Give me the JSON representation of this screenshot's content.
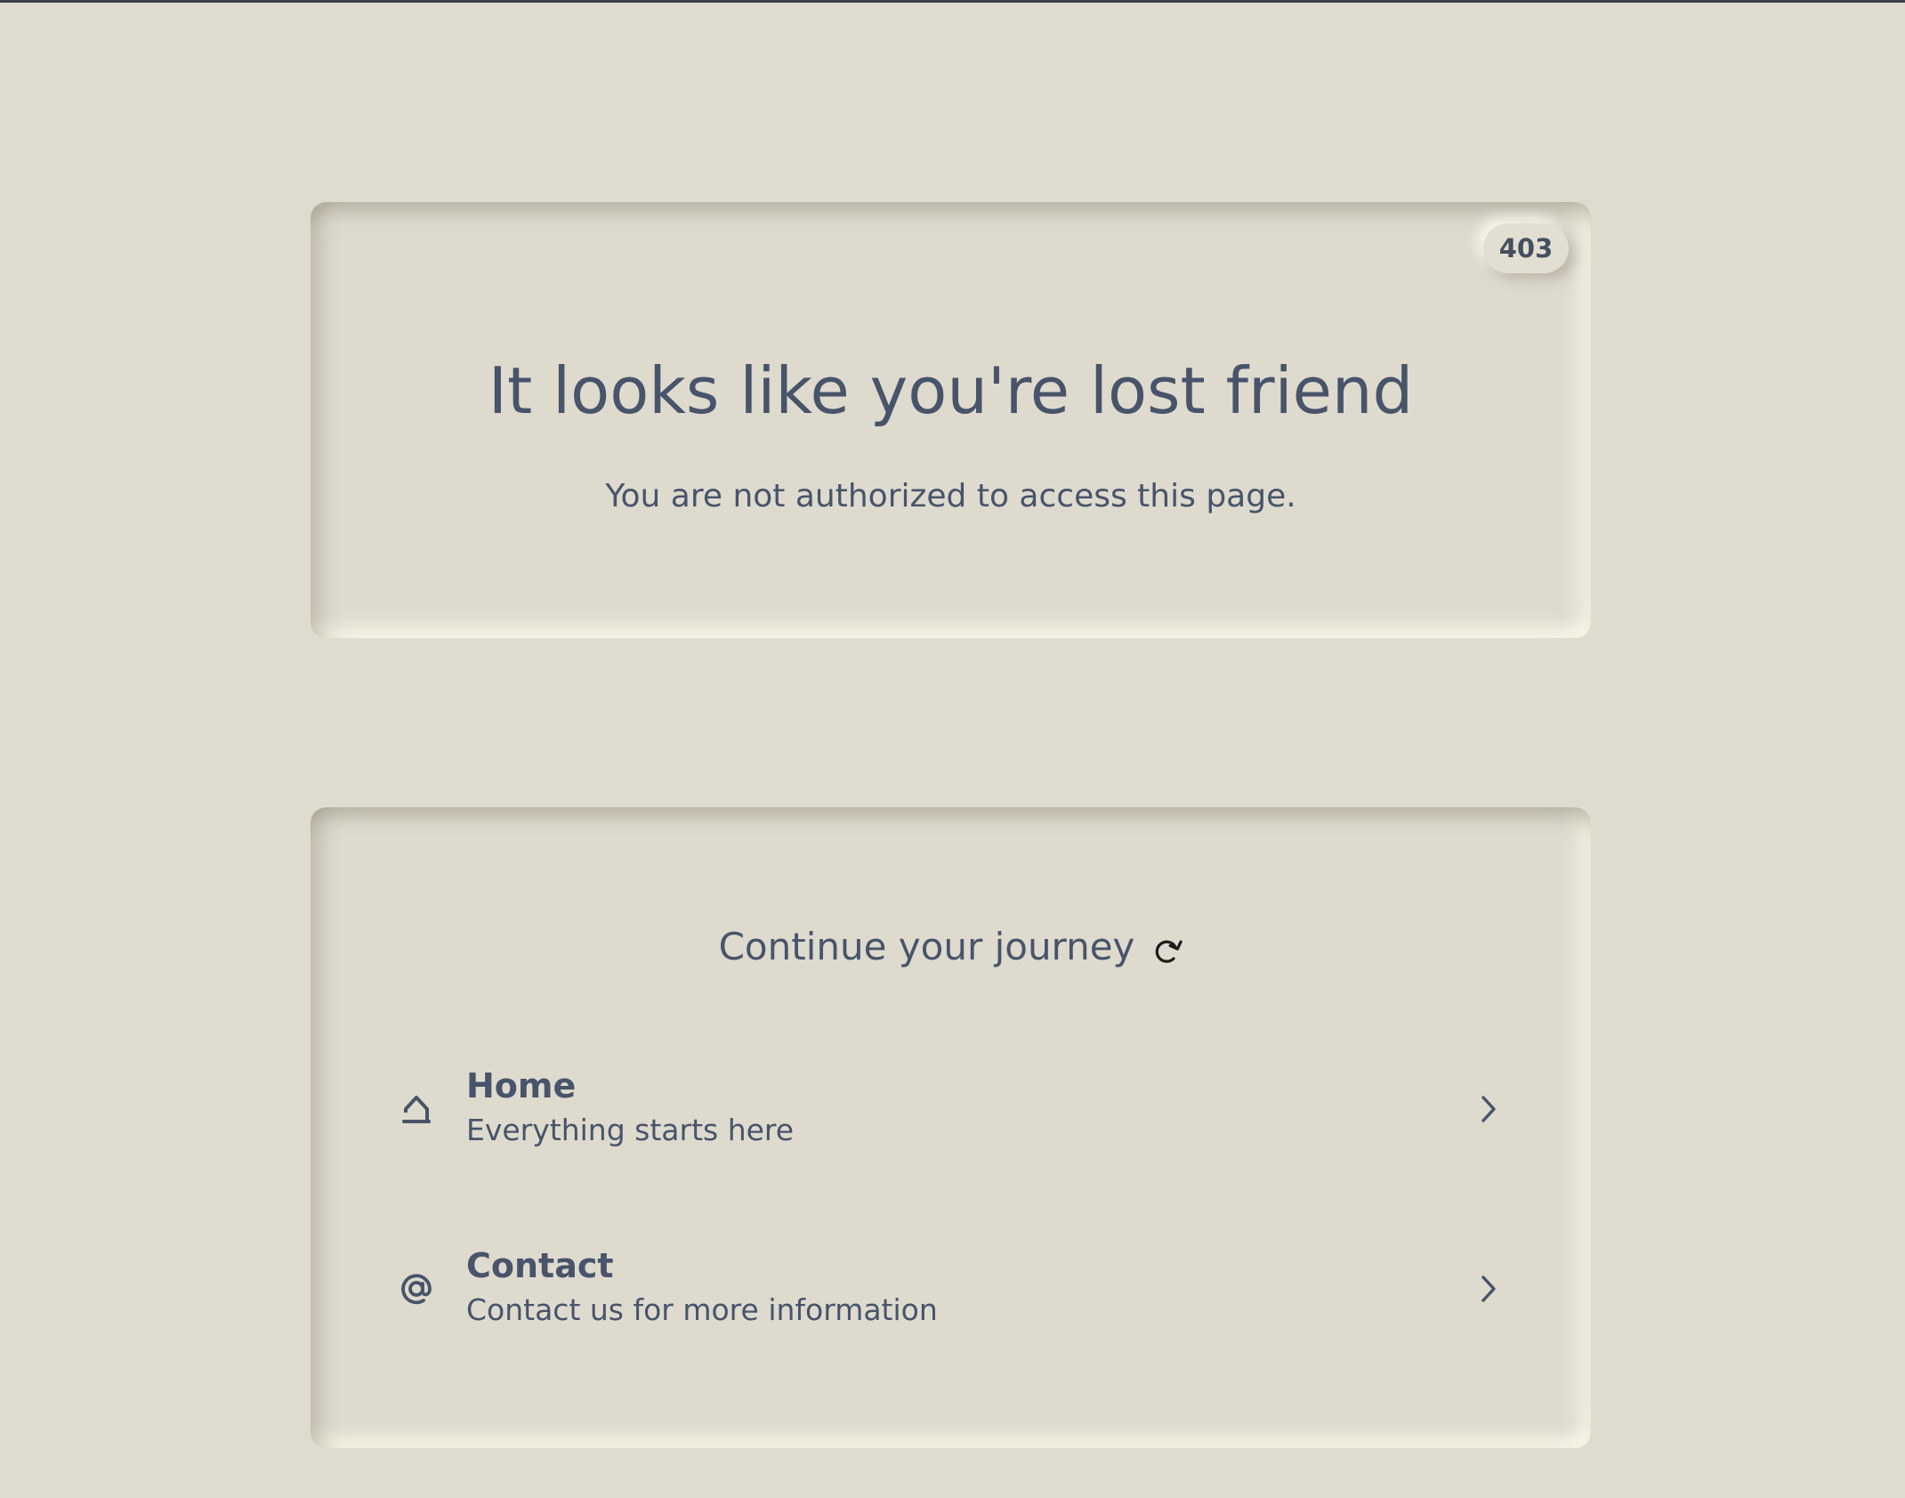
{
  "error_card": {
    "code": "403",
    "title": "It looks like you're lost friend",
    "subtitle": "You are not authorized to access this page."
  },
  "journey_card": {
    "heading": "Continue your journey",
    "heading_icon": "refresh-arrow-icon",
    "links": [
      {
        "title": "Home",
        "description": "Everything starts here",
        "icon": "home-icon"
      },
      {
        "title": "Contact",
        "description": "Contact us for more information",
        "icon": "at-sign-icon"
      }
    ]
  },
  "colors": {
    "background": "#dfdbcf",
    "text": "#47546a",
    "top_border": "#3c4147"
  }
}
